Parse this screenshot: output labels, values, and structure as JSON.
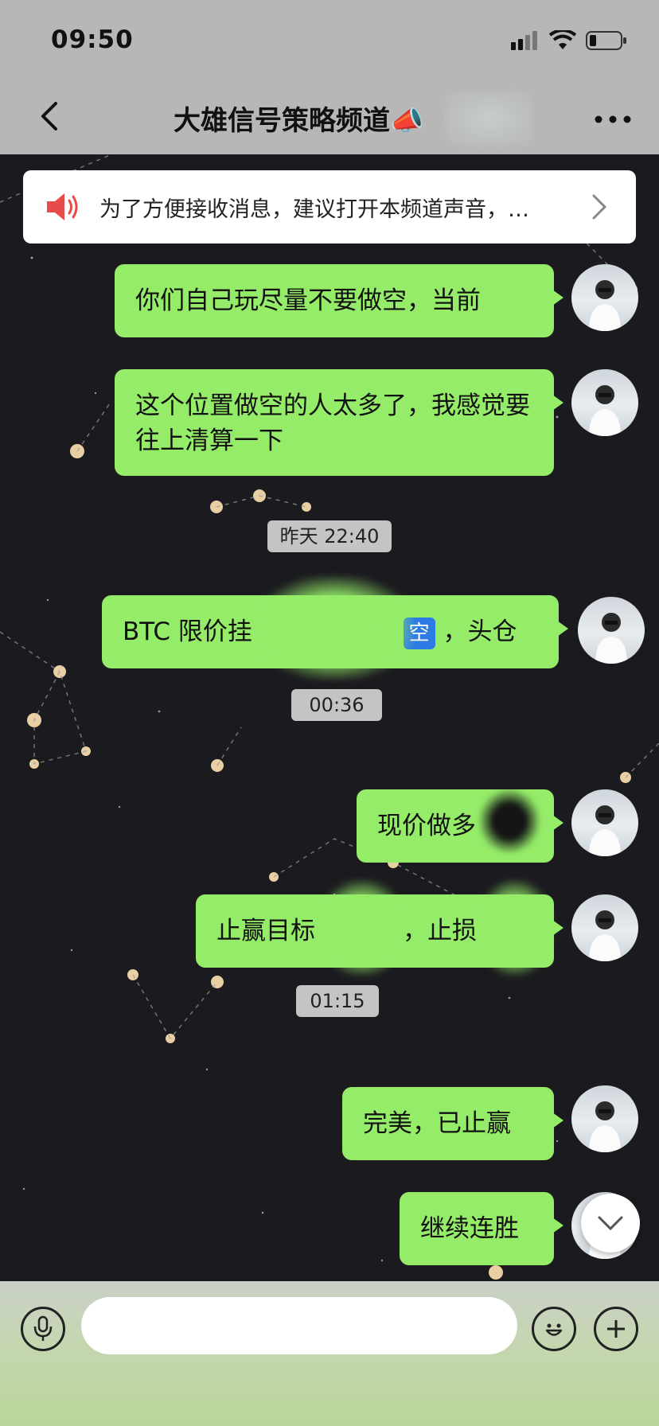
{
  "status_bar": {
    "time": "09:50"
  },
  "header": {
    "title": "大雄信号策略频道📣"
  },
  "notice": {
    "text": "为了方便接收消息，建议打开本频道声音，…"
  },
  "messages": [
    {
      "text": "你们自己玩尽量不要做空，当前"
    },
    {
      "text": "这个位置做空的人太多了，我感觉要往上清算一下"
    },
    {
      "timestamp": "昨天 22:40"
    },
    {
      "text_prefix": "BTC 限价挂",
      "emoji": "空",
      "text_suffix": "，头仓"
    },
    {
      "timestamp": "00:36"
    },
    {
      "text": "现价做多"
    },
    {
      "text_a": "止赢目标",
      "text_b": "，止损"
    },
    {
      "timestamp": "01:15"
    },
    {
      "text": "完美，已止赢"
    },
    {
      "text": "继续连胜"
    }
  ],
  "colors": {
    "bubble": "#95ec69",
    "header_bg": "#b7b7b7",
    "chat_bg": "#1b1b1f"
  },
  "icons": [
    "back-icon",
    "more-icon",
    "speaker-icon",
    "chevron-right-icon",
    "chevron-down-icon",
    "microphone-icon",
    "emoji-icon",
    "plus-icon"
  ]
}
